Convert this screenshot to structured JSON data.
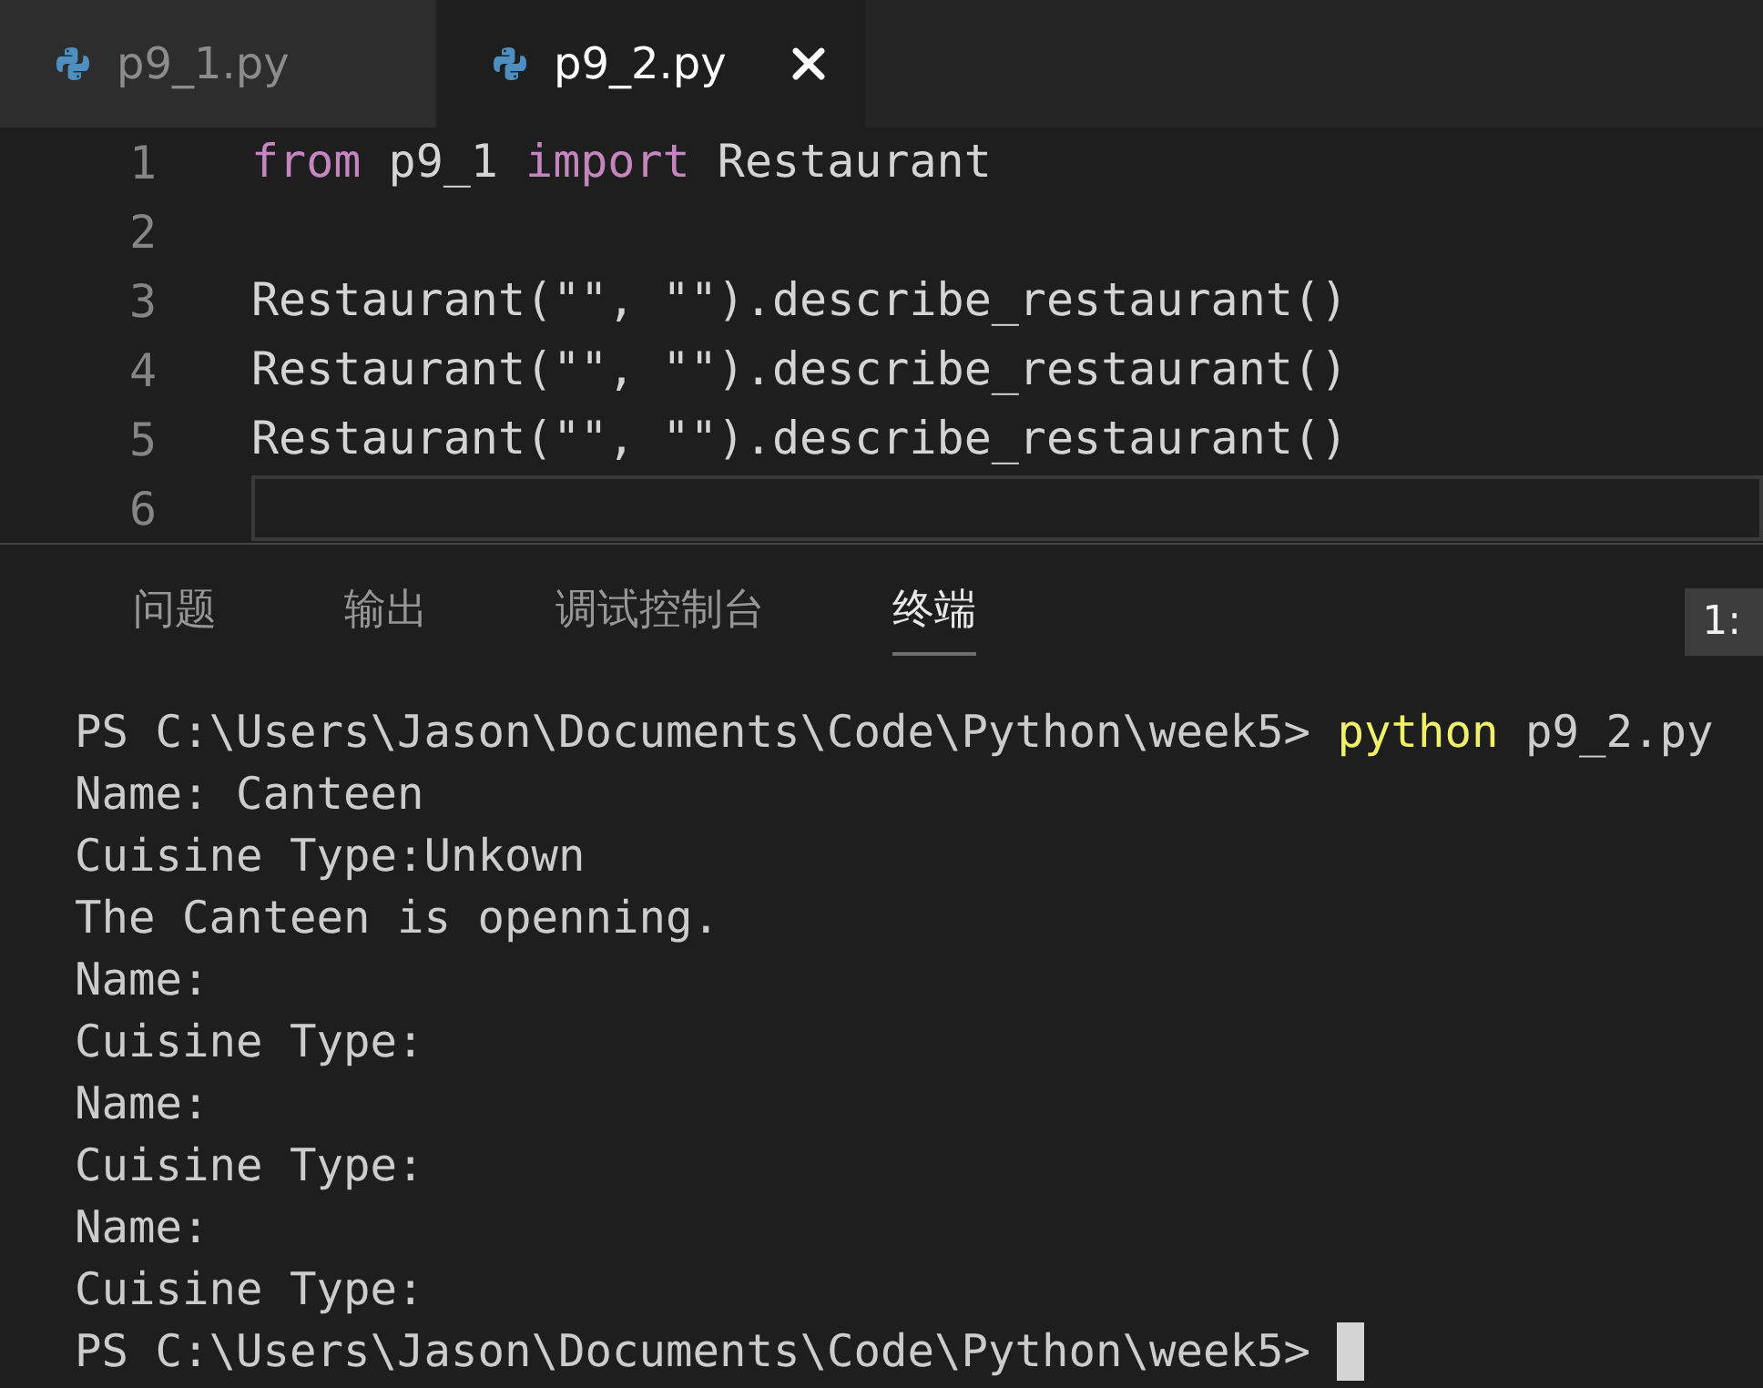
{
  "tabs": [
    {
      "label": "p9_1.py",
      "selected": false
    },
    {
      "label": "p9_2.py",
      "selected": true
    }
  ],
  "editor": {
    "lines": [
      {
        "number": "1",
        "tokens": [
          {
            "kind": "keyword",
            "text": "from"
          },
          {
            "kind": "plain",
            "text": " p9_1 "
          },
          {
            "kind": "keyword",
            "text": "import"
          },
          {
            "kind": "plain",
            "text": " Restaurant"
          }
        ]
      },
      {
        "number": "2"
      },
      {
        "number": "3",
        "tokens": [
          {
            "kind": "plain",
            "text": "Restaurant(\"\", \"\").describe_restaurant()"
          }
        ]
      },
      {
        "number": "4",
        "tokens": [
          {
            "kind": "plain",
            "text": "Restaurant(\"\", \"\").describe_restaurant()"
          }
        ]
      },
      {
        "number": "5",
        "tokens": [
          {
            "kind": "plain",
            "text": "Restaurant(\"\", \"\").describe_restaurant()"
          }
        ]
      },
      {
        "number": "6",
        "current": true
      }
    ]
  },
  "panel": {
    "tabs": [
      {
        "label": "问题",
        "selected": false
      },
      {
        "label": "输出",
        "selected": false
      },
      {
        "label": "调试控制台",
        "selected": false
      },
      {
        "label": "终端",
        "selected": true
      }
    ],
    "terminal_selector": "1:",
    "terminal_lines": [
      [
        {
          "kind": "plain",
          "text": "PS C:\\Users\\Jason\\Documents\\Code\\Python\\week5> "
        },
        {
          "kind": "command",
          "text": "python"
        },
        {
          "kind": "plain",
          "text": " p9_2.py"
        }
      ],
      [
        {
          "kind": "plain",
          "text": "Name: Canteen"
        }
      ],
      [
        {
          "kind": "plain",
          "text": "Cuisine Type:Unkown"
        }
      ],
      [
        {
          "kind": "plain",
          "text": "The Canteen is openning."
        }
      ],
      [
        {
          "kind": "plain",
          "text": "Name:"
        }
      ],
      [
        {
          "kind": "plain",
          "text": "Cuisine Type:"
        }
      ],
      [
        {
          "kind": "plain",
          "text": "Name:"
        }
      ],
      [
        {
          "kind": "plain",
          "text": "Cuisine Type:"
        }
      ],
      [
        {
          "kind": "plain",
          "text": "Name:"
        }
      ],
      [
        {
          "kind": "plain",
          "text": "Cuisine Type:"
        }
      ],
      [
        {
          "kind": "plain",
          "text": "PS C:\\Users\\Jason\\Documents\\Code\\Python\\week5> "
        },
        {
          "kind": "cursor"
        }
      ]
    ]
  }
}
